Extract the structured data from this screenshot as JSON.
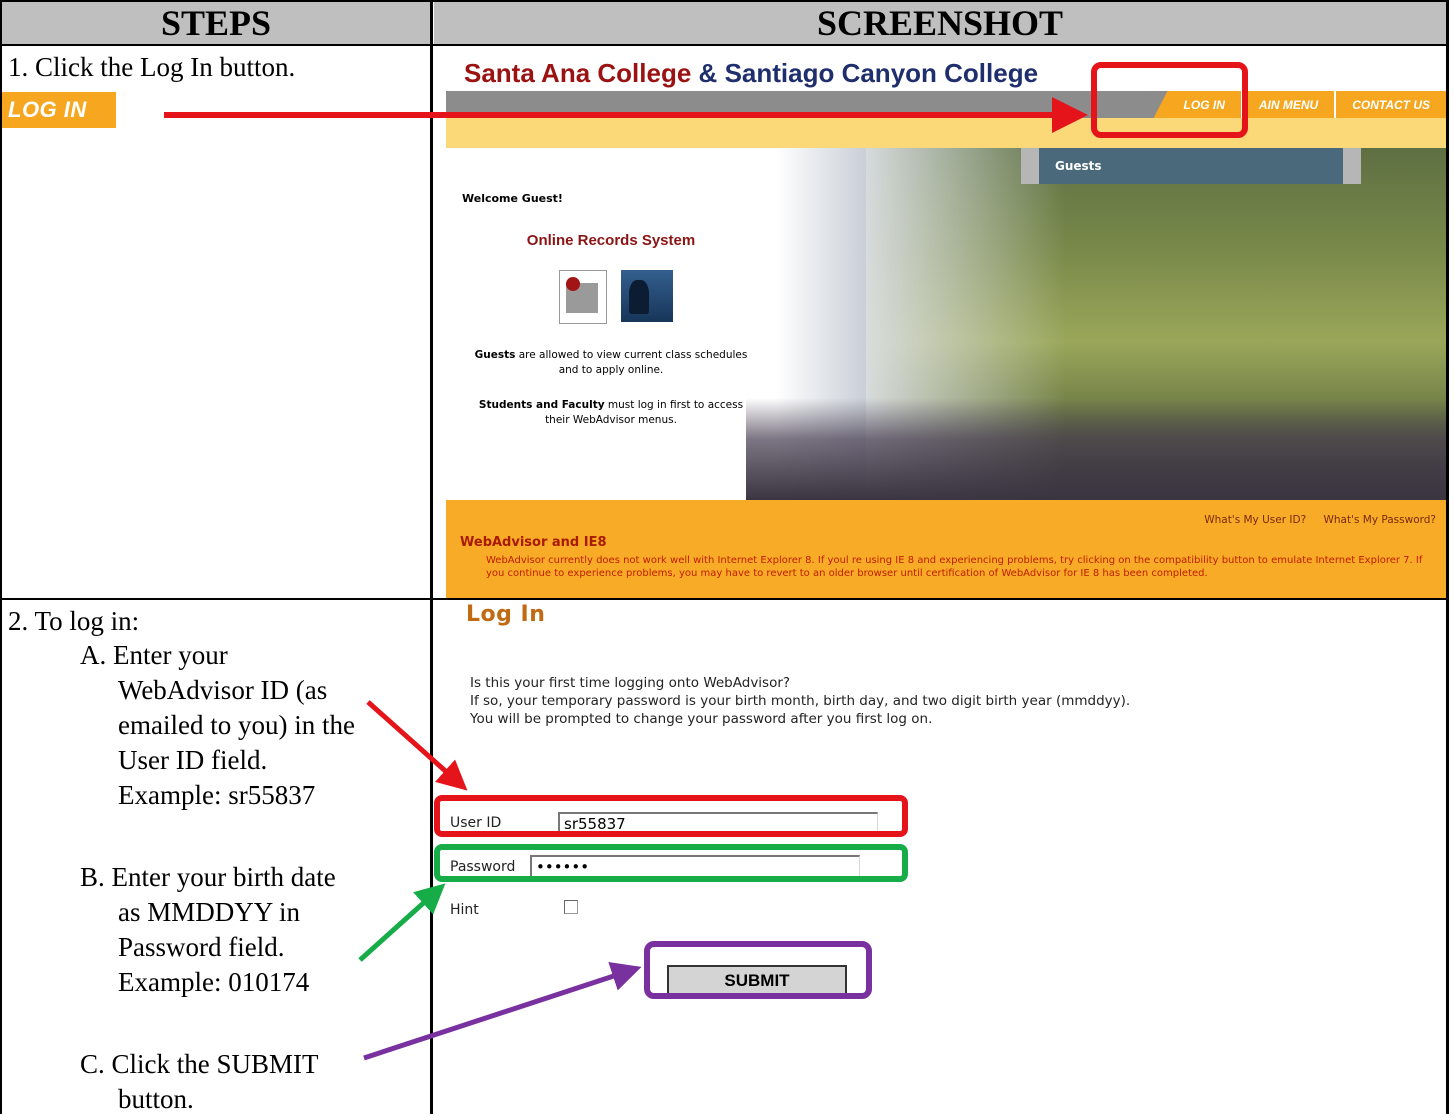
{
  "table": {
    "header_steps": "STEPS",
    "header_screenshot": "SCREENSHOT"
  },
  "step1": {
    "text": "1.  Click the Log In button.",
    "badge_label": "LOG IN"
  },
  "step2": {
    "intro": "2.  To log in:",
    "a_lines": [
      "A.  Enter your",
      "WebAdvisor ID (as",
      "emailed to you) in the",
      "User ID field.",
      "Example: sr55837"
    ],
    "b_lines": [
      "B.  Enter your birth date",
      "as MMDDYY in",
      "Password field.",
      "Example: 010174"
    ],
    "c_lines": [
      "C.  Click the SUBMIT",
      "button."
    ]
  },
  "screenshot1": {
    "college_name_1": "Santa Ana College",
    "ampersand": "&",
    "college_name_2": "Santiago Canyon College",
    "nav": [
      "LOG IN",
      "AIN MENU",
      "CONTACT US"
    ],
    "guests_header": "Guests",
    "welcome": "Welcome Guest!",
    "system_title": "Online Records System",
    "guests_bold": "Guests",
    "guests_text_1": " are allowed to view current class schedules",
    "guests_text_2": "and to apply online.",
    "students_bold": "Students and Faculty",
    "students_text_1": " must log in first to access",
    "students_text_2": "their WebAdvisor menus.",
    "link_userid": "What's My User ID?",
    "link_password": "What's My Password?",
    "ie8_title": "WebAdvisor and IE8",
    "ie8_body": "WebAdvisor currently does not work well with Internet Explorer 8. If youl re using IE 8 and experiencing problems, try clicking on the compatibility button to emulate Internet Explorer 7. If you continue to experience problems, you may have to revert to an older browser until certification of WebAdvisor for IE 8 has been completed."
  },
  "screenshot2": {
    "heading": "Log In",
    "info_1": "Is this your first time logging onto WebAdvisor?",
    "info_2": "If so, your temporary password is your birth month, birth day, and two digit birth year (mmddyy).",
    "info_3": "You will be prompted to change your password after you first log on.",
    "userid_label": "User ID",
    "userid_value": "sr55837",
    "password_label": "Password",
    "password_value": "••••••",
    "hint_label": "Hint",
    "submit_label": "SUBMIT"
  },
  "colors": {
    "red_highlight": "#e5141b",
    "green_highlight": "#16ac48",
    "purple_highlight": "#7a31a0",
    "header_gray": "#bfbfbf",
    "orange": "#f6a71f"
  }
}
